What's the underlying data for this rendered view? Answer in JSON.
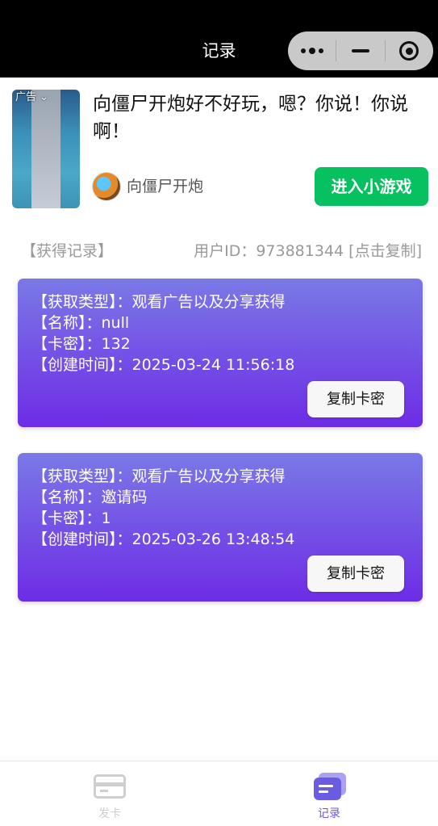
{
  "navbar": {
    "title": "记录",
    "capsule_icons": [
      "more-dots-icon",
      "minimize-icon",
      "close-target-icon"
    ]
  },
  "ad": {
    "tag": "广告",
    "title": "向僵尸开炮好不好玩，嗯？你说！你说啊！",
    "name": "向僵尸开炮",
    "button": "进入小游戏",
    "button_color": "#07c160"
  },
  "header": {
    "left": "【获得记录】",
    "right": "用户ID：973881344 [点击复制]"
  },
  "records": [
    {
      "type": "【获取类型】：观看广告以及分享获得",
      "name": "【名称】：null",
      "code": "【卡密】：132",
      "time": "【创建时间】：2025-03-24 11:56:18",
      "copy": "复制卡密"
    },
    {
      "type": "【获取类型】：观看广告以及分享获得",
      "name": "【名称】：邀请码",
      "code": "【卡密】：1",
      "time": "【创建时间】：2025-03-26 13:48:54",
      "copy": "复制卡密"
    }
  ],
  "tabbar": {
    "tabs": [
      {
        "label": "发卡",
        "icon": "card-icon",
        "active": false
      },
      {
        "label": "记录",
        "icon": "records-icon",
        "active": true
      }
    ],
    "active_color": "#6b5be0",
    "inactive_color": "#cfcfcf"
  },
  "colors": {
    "card_gradient_top": "#7a79e6",
    "card_gradient_bottom": "#6e2ce6"
  }
}
